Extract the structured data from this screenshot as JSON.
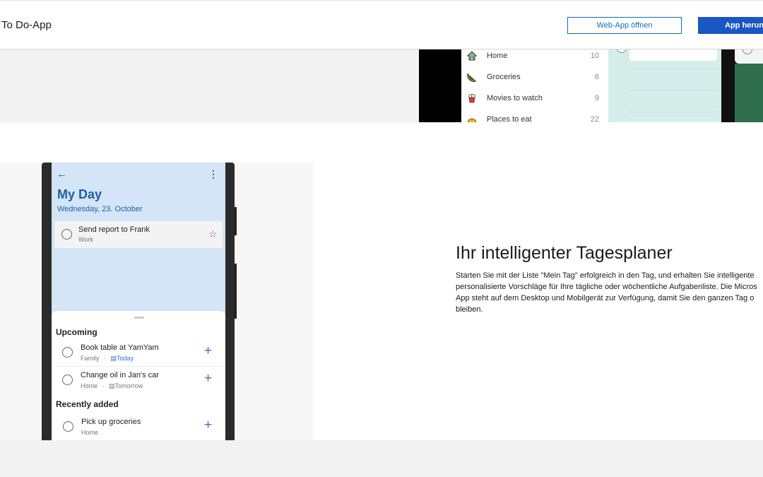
{
  "header": {
    "brand": "To Do-App",
    "web_app_button": "Web-App öffnen",
    "download_button": "App herunte"
  },
  "colors": {
    "primary_blue": "#1a56c4",
    "outline_blue": "#0f6cbd",
    "myday_blue": "#1f5fa6",
    "screen_bg": "#d3e5f6",
    "teal": "#d5eeea"
  },
  "top_lists": [
    {
      "icon": "house-icon",
      "label": "Home",
      "count": "10"
    },
    {
      "icon": "watermelon-icon",
      "label": "Groceries",
      "count": "6"
    },
    {
      "icon": "popcorn-icon",
      "label": "Movies to watch",
      "count": "9"
    },
    {
      "icon": "taco-icon",
      "label": "Places to eat",
      "count": "22"
    }
  ],
  "phone": {
    "title": "My Day",
    "date": "Wednesday, 23. October",
    "pinned_task": {
      "title": "Send report to Frank",
      "list": "Work"
    },
    "upcoming_label": "Upcoming",
    "upcoming": [
      {
        "title": "Book table at YamYam",
        "list": "Family",
        "separator": "·",
        "due": "Today"
      },
      {
        "title": "Change oil in Jan's car",
        "list": "Home",
        "separator": "·",
        "due": "Tomorrow"
      }
    ],
    "recent_label": "Recently added",
    "recent": [
      {
        "title": "Pick up groceries",
        "list": "Home"
      }
    ]
  },
  "feature": {
    "heading": "Ihr intelligenter Tagesplaner",
    "lines": [
      "Starten Sie mit der Liste \"Mein Tag\" erfolgreich in den Tag, und erhalten Sie intelligente",
      "personalisierte Vorschläge für Ihre tägliche oder wöchentliche Aufgabenliste. Die Micros",
      "App steht auf dem Desktop und Mobilgerät zur Verfügung, damit Sie den ganzen Tag o",
      "bleiben."
    ]
  }
}
